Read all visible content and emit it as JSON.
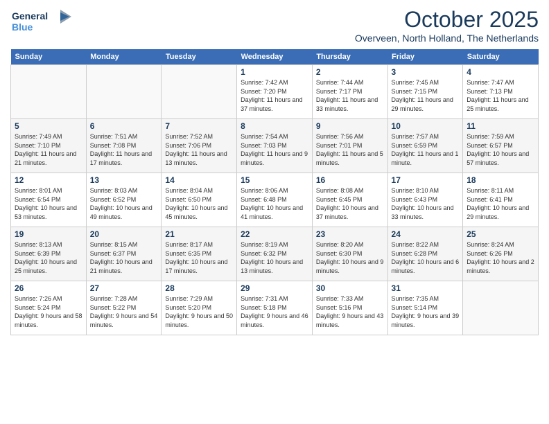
{
  "logo": {
    "line1": "General",
    "line2": "Blue"
  },
  "title": "October 2025",
  "subtitle": "Overveen, North Holland, The Netherlands",
  "weekdays": [
    "Sunday",
    "Monday",
    "Tuesday",
    "Wednesday",
    "Thursday",
    "Friday",
    "Saturday"
  ],
  "weeks": [
    [
      {
        "day": "",
        "sunrise": "",
        "sunset": "",
        "daylight": ""
      },
      {
        "day": "",
        "sunrise": "",
        "sunset": "",
        "daylight": ""
      },
      {
        "day": "",
        "sunrise": "",
        "sunset": "",
        "daylight": ""
      },
      {
        "day": "1",
        "sunrise": "Sunrise: 7:42 AM",
        "sunset": "Sunset: 7:20 PM",
        "daylight": "Daylight: 11 hours and 37 minutes."
      },
      {
        "day": "2",
        "sunrise": "Sunrise: 7:44 AM",
        "sunset": "Sunset: 7:17 PM",
        "daylight": "Daylight: 11 hours and 33 minutes."
      },
      {
        "day": "3",
        "sunrise": "Sunrise: 7:45 AM",
        "sunset": "Sunset: 7:15 PM",
        "daylight": "Daylight: 11 hours and 29 minutes."
      },
      {
        "day": "4",
        "sunrise": "Sunrise: 7:47 AM",
        "sunset": "Sunset: 7:13 PM",
        "daylight": "Daylight: 11 hours and 25 minutes."
      }
    ],
    [
      {
        "day": "5",
        "sunrise": "Sunrise: 7:49 AM",
        "sunset": "Sunset: 7:10 PM",
        "daylight": "Daylight: 11 hours and 21 minutes."
      },
      {
        "day": "6",
        "sunrise": "Sunrise: 7:51 AM",
        "sunset": "Sunset: 7:08 PM",
        "daylight": "Daylight: 11 hours and 17 minutes."
      },
      {
        "day": "7",
        "sunrise": "Sunrise: 7:52 AM",
        "sunset": "Sunset: 7:06 PM",
        "daylight": "Daylight: 11 hours and 13 minutes."
      },
      {
        "day": "8",
        "sunrise": "Sunrise: 7:54 AM",
        "sunset": "Sunset: 7:03 PM",
        "daylight": "Daylight: 11 hours and 9 minutes."
      },
      {
        "day": "9",
        "sunrise": "Sunrise: 7:56 AM",
        "sunset": "Sunset: 7:01 PM",
        "daylight": "Daylight: 11 hours and 5 minutes."
      },
      {
        "day": "10",
        "sunrise": "Sunrise: 7:57 AM",
        "sunset": "Sunset: 6:59 PM",
        "daylight": "Daylight: 11 hours and 1 minute."
      },
      {
        "day": "11",
        "sunrise": "Sunrise: 7:59 AM",
        "sunset": "Sunset: 6:57 PM",
        "daylight": "Daylight: 10 hours and 57 minutes."
      }
    ],
    [
      {
        "day": "12",
        "sunrise": "Sunrise: 8:01 AM",
        "sunset": "Sunset: 6:54 PM",
        "daylight": "Daylight: 10 hours and 53 minutes."
      },
      {
        "day": "13",
        "sunrise": "Sunrise: 8:03 AM",
        "sunset": "Sunset: 6:52 PM",
        "daylight": "Daylight: 10 hours and 49 minutes."
      },
      {
        "day": "14",
        "sunrise": "Sunrise: 8:04 AM",
        "sunset": "Sunset: 6:50 PM",
        "daylight": "Daylight: 10 hours and 45 minutes."
      },
      {
        "day": "15",
        "sunrise": "Sunrise: 8:06 AM",
        "sunset": "Sunset: 6:48 PM",
        "daylight": "Daylight: 10 hours and 41 minutes."
      },
      {
        "day": "16",
        "sunrise": "Sunrise: 8:08 AM",
        "sunset": "Sunset: 6:45 PM",
        "daylight": "Daylight: 10 hours and 37 minutes."
      },
      {
        "day": "17",
        "sunrise": "Sunrise: 8:10 AM",
        "sunset": "Sunset: 6:43 PM",
        "daylight": "Daylight: 10 hours and 33 minutes."
      },
      {
        "day": "18",
        "sunrise": "Sunrise: 8:11 AM",
        "sunset": "Sunset: 6:41 PM",
        "daylight": "Daylight: 10 hours and 29 minutes."
      }
    ],
    [
      {
        "day": "19",
        "sunrise": "Sunrise: 8:13 AM",
        "sunset": "Sunset: 6:39 PM",
        "daylight": "Daylight: 10 hours and 25 minutes."
      },
      {
        "day": "20",
        "sunrise": "Sunrise: 8:15 AM",
        "sunset": "Sunset: 6:37 PM",
        "daylight": "Daylight: 10 hours and 21 minutes."
      },
      {
        "day": "21",
        "sunrise": "Sunrise: 8:17 AM",
        "sunset": "Sunset: 6:35 PM",
        "daylight": "Daylight: 10 hours and 17 minutes."
      },
      {
        "day": "22",
        "sunrise": "Sunrise: 8:19 AM",
        "sunset": "Sunset: 6:32 PM",
        "daylight": "Daylight: 10 hours and 13 minutes."
      },
      {
        "day": "23",
        "sunrise": "Sunrise: 8:20 AM",
        "sunset": "Sunset: 6:30 PM",
        "daylight": "Daylight: 10 hours and 9 minutes."
      },
      {
        "day": "24",
        "sunrise": "Sunrise: 8:22 AM",
        "sunset": "Sunset: 6:28 PM",
        "daylight": "Daylight: 10 hours and 6 minutes."
      },
      {
        "day": "25",
        "sunrise": "Sunrise: 8:24 AM",
        "sunset": "Sunset: 6:26 PM",
        "daylight": "Daylight: 10 hours and 2 minutes."
      }
    ],
    [
      {
        "day": "26",
        "sunrise": "Sunrise: 7:26 AM",
        "sunset": "Sunset: 5:24 PM",
        "daylight": "Daylight: 9 hours and 58 minutes."
      },
      {
        "day": "27",
        "sunrise": "Sunrise: 7:28 AM",
        "sunset": "Sunset: 5:22 PM",
        "daylight": "Daylight: 9 hours and 54 minutes."
      },
      {
        "day": "28",
        "sunrise": "Sunrise: 7:29 AM",
        "sunset": "Sunset: 5:20 PM",
        "daylight": "Daylight: 9 hours and 50 minutes."
      },
      {
        "day": "29",
        "sunrise": "Sunrise: 7:31 AM",
        "sunset": "Sunset: 5:18 PM",
        "daylight": "Daylight: 9 hours and 46 minutes."
      },
      {
        "day": "30",
        "sunrise": "Sunrise: 7:33 AM",
        "sunset": "Sunset: 5:16 PM",
        "daylight": "Daylight: 9 hours and 43 minutes."
      },
      {
        "day": "31",
        "sunrise": "Sunrise: 7:35 AM",
        "sunset": "Sunset: 5:14 PM",
        "daylight": "Daylight: 9 hours and 39 minutes."
      },
      {
        "day": "",
        "sunrise": "",
        "sunset": "",
        "daylight": ""
      }
    ]
  ]
}
